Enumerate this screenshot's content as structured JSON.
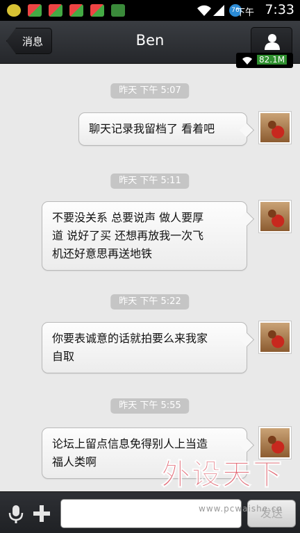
{
  "status_bar": {
    "ampm": "下午",
    "time": "7:33",
    "net_speed": "82.1M",
    "battery": "76"
  },
  "header": {
    "back_label": "消息",
    "title": "Ben"
  },
  "messages": [
    {
      "timestamp": "昨天 下午 5:07",
      "text_lines": [
        "聊天记录我留档了 看着吧"
      ]
    },
    {
      "timestamp": "昨天 下午 5:11",
      "text_lines": [
        "不要没关系 总要说声 做人要厚",
        "道 说好了买 还想再放我一次飞",
        "机还好意思再送地铁"
      ]
    },
    {
      "timestamp": "昨天 下午 5:22",
      "text_lines": [
        "你要表诚意的话就拍要么来我家",
        "自取"
      ]
    },
    {
      "timestamp": "昨天 下午 5:55",
      "text_lines": [
        "论坛上留点信息免得别人上当造",
        "福人类啊"
      ]
    }
  ],
  "input_bar": {
    "placeholder": "",
    "send_label": "发送"
  },
  "watermark": {
    "logo": "外设天下",
    "url": "www.pcwaishe.cn"
  },
  "icons": [
    "chat-notify-icon",
    "app-notify-icon",
    "wifi-icon",
    "signal-icon",
    "battery-icon",
    "back-arrow-icon",
    "profile-icon",
    "mic-icon",
    "plus-icon"
  ],
  "colors": {
    "header": "#2c2e33",
    "background": "#e9e9e9",
    "timestamp_pill": "#c5c5c5",
    "bubble": "#f6f6f6",
    "watermark": "#e04050"
  }
}
